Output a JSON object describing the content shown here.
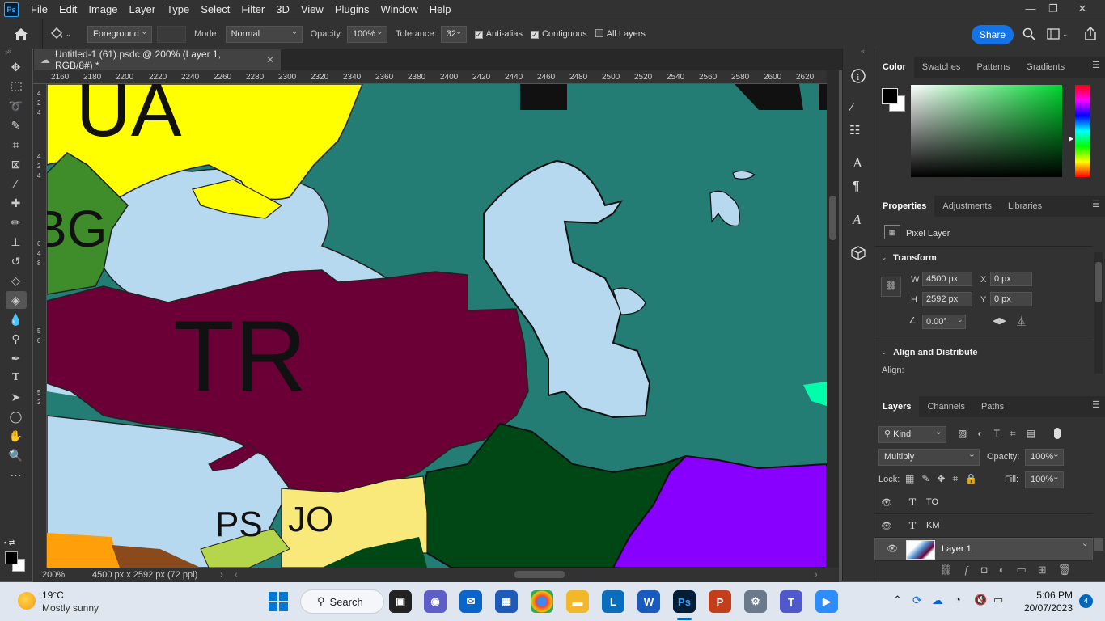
{
  "app": {
    "logo": "Ps",
    "menus": [
      "File",
      "Edit",
      "Image",
      "Layer",
      "Type",
      "Select",
      "Filter",
      "3D",
      "View",
      "Plugins",
      "Window",
      "Help"
    ],
    "window_controls": [
      "minimize-icon",
      "restore-icon",
      "close-icon"
    ]
  },
  "options": {
    "fill_source": "Foreground",
    "mode_label": "Mode:",
    "mode_value": "Normal",
    "opacity_label": "Opacity:",
    "opacity_value": "100%",
    "tolerance_label": "Tolerance:",
    "tolerance_value": "32",
    "antialias_label": "Anti-alias",
    "antialias_checked": true,
    "contiguous_label": "Contiguous",
    "contiguous_checked": true,
    "all_layers_label": "All Layers",
    "all_layers_checked": false,
    "share_label": "Share"
  },
  "document": {
    "tab_title": "Untitled-1 (61).psdc @ 200% (Layer 1, RGB/8#) *",
    "ruler_h": [
      "2160",
      "2180",
      "2200",
      "2220",
      "2240",
      "2260",
      "2280",
      "2300",
      "2320",
      "2340",
      "2360",
      "2380",
      "2400",
      "2420",
      "2440",
      "2460",
      "2480",
      "2500",
      "2520",
      "2540",
      "2560",
      "2580",
      "2600",
      "2620"
    ],
    "ruler_v": [
      "4",
      "2",
      "4",
      "4",
      "2",
      "4",
      "6",
      "4",
      "8",
      "5",
      "0",
      "5",
      "2"
    ],
    "zoom": "200%",
    "doc_info": "4500 px x 2592 px (72 ppi)",
    "map_labels": {
      "ua": "UA",
      "bg": "BG",
      "tr": "TR",
      "ps": "PS",
      "jo": "JO"
    }
  },
  "panels": {
    "color_tabs": [
      "Color",
      "Swatches",
      "Patterns",
      "Gradients"
    ],
    "properties_tabs": [
      "Properties",
      "Adjustments",
      "Libraries"
    ],
    "pixel_layer_label": "Pixel Layer",
    "transform_label": "Transform",
    "w_label": "W",
    "w_value": "4500 px",
    "h_label": "H",
    "h_value": "2592 px",
    "x_label": "X",
    "x_value": "0 px",
    "y_label": "Y",
    "y_value": "0 px",
    "angle_value": "0.00°",
    "align_label": "Align and Distribute",
    "align_sub": "Align:",
    "layers_tabs": [
      "Layers",
      "Channels",
      "Paths"
    ],
    "kind_label": "Kind",
    "blend_mode": "Multiply",
    "layer_opacity_label": "Opacity:",
    "layer_opacity_value": "100%",
    "lock_label": "Lock:",
    "fill_label": "Fill:",
    "fill_value": "100%",
    "layers": [
      {
        "name": "TO",
        "kind": "T"
      },
      {
        "name": "KM",
        "kind": "T"
      },
      {
        "name": "Layer 1",
        "kind": "pixel"
      }
    ]
  },
  "taskbar": {
    "weather_temp": "19°C",
    "weather_desc": "Mostly sunny",
    "search_label": "Search",
    "time": "5:06 PM",
    "date": "20/07/2023",
    "notif_count": "4"
  },
  "colors": {
    "accent": "#1473e6",
    "sea": "#b7d9f0",
    "teal": "#237d74",
    "turkey": "#6b0037",
    "yellow": "#ffff00",
    "green": "#3f8d2a",
    "darkgreen": "#004716",
    "purple": "#8800ff",
    "sand": "#f8e97a"
  }
}
